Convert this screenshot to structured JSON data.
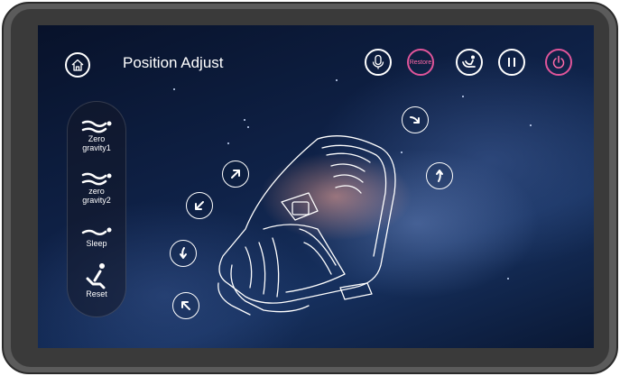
{
  "header": {
    "title": "Position  Adjust",
    "home_icon": "home-icon"
  },
  "toolbar": {
    "buttons": [
      {
        "name": "microphone-button",
        "icon": "microphone-icon"
      },
      {
        "name": "restore-button",
        "label": "Restore"
      },
      {
        "name": "massage-mode-button",
        "icon": "recline-person-icon"
      },
      {
        "name": "pause-button",
        "icon": "pause-icon"
      },
      {
        "name": "power-button",
        "icon": "power-icon"
      }
    ]
  },
  "sidebar": {
    "items": [
      {
        "label_line1": "Zero",
        "label_line2": "gravity1",
        "icon": "zero-gravity-icon"
      },
      {
        "label_line1": "zero",
        "label_line2": "gravity2",
        "icon": "zero-gravity-icon"
      },
      {
        "label_line1": "Sleep",
        "label_line2": "",
        "icon": "sleep-icon"
      },
      {
        "label_line1": "Reset",
        "label_line2": "",
        "icon": "reset-seat-icon"
      }
    ]
  },
  "colors": {
    "accent_pink": "#e0559a",
    "icon_white": "#ffffff"
  }
}
